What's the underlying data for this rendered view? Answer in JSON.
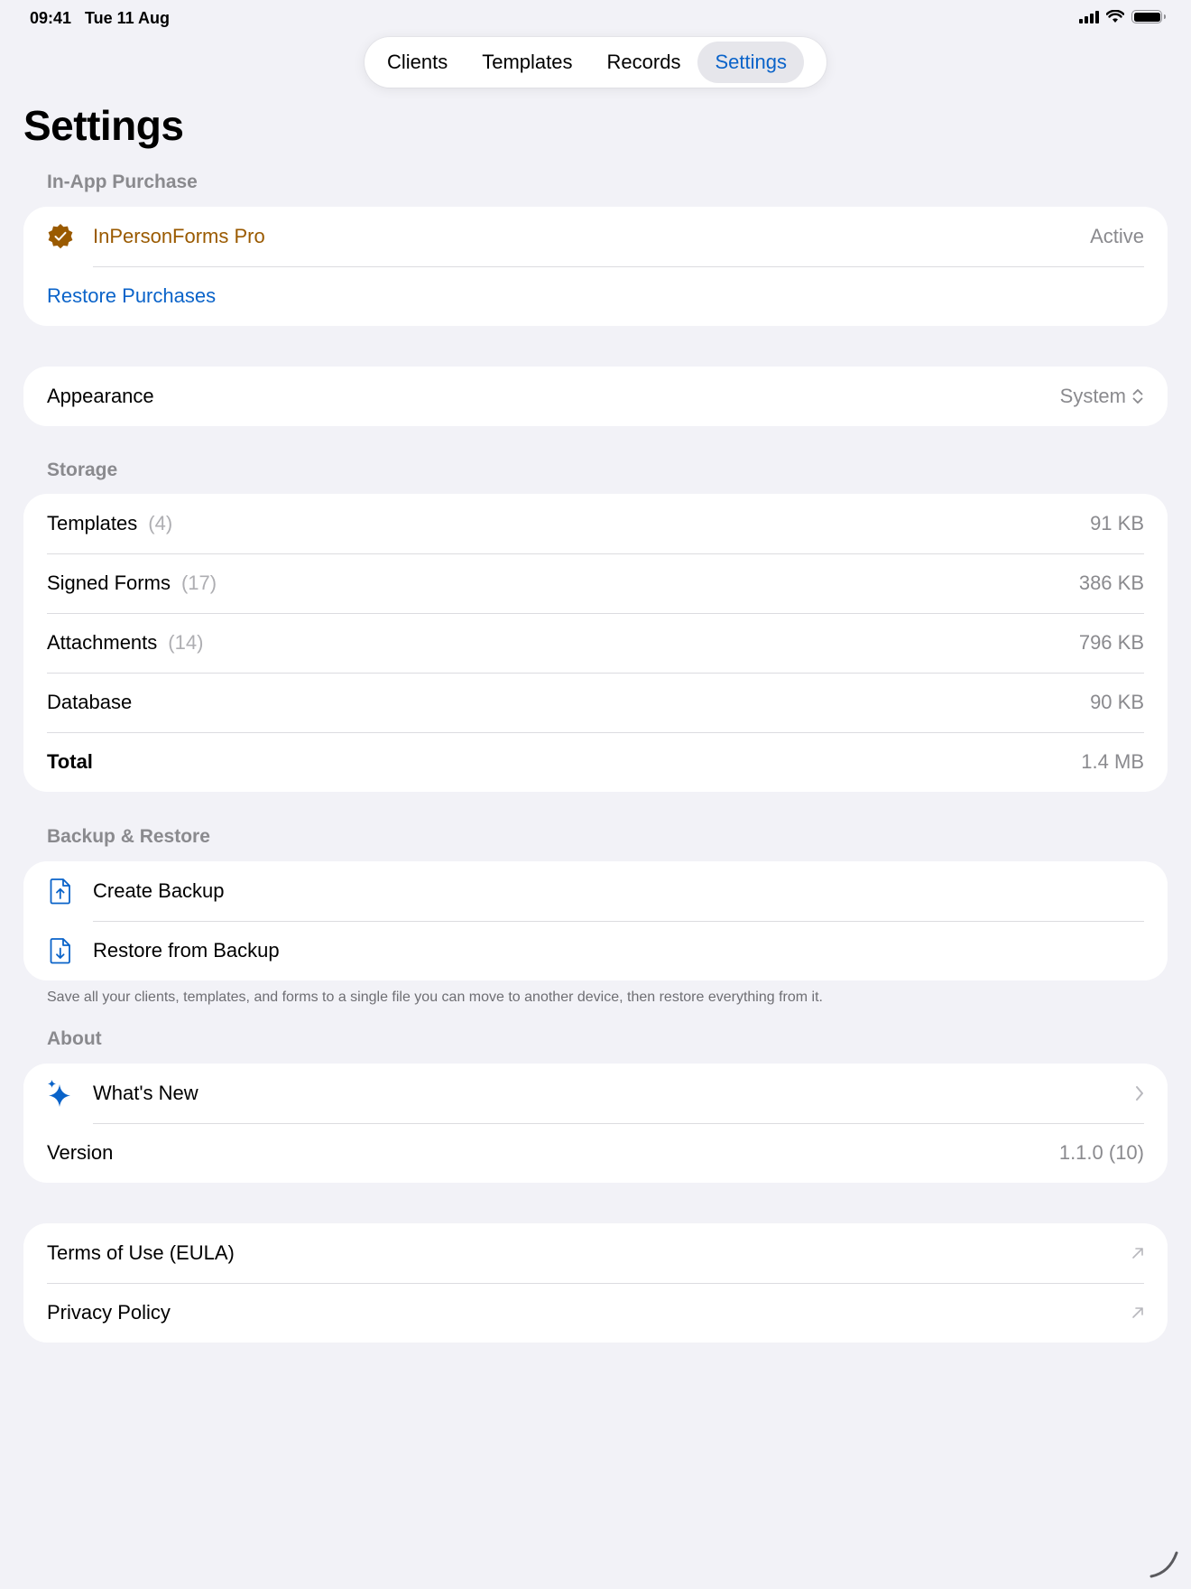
{
  "status": {
    "time": "09:41",
    "date": "Tue 11 Aug"
  },
  "tabs": [
    {
      "label": "Clients"
    },
    {
      "label": "Templates"
    },
    {
      "label": "Records"
    },
    {
      "label": "Settings"
    }
  ],
  "title": "Settings",
  "purchase": {
    "header": "In-App Purchase",
    "product": "InPersonForms Pro",
    "status": "Active",
    "restore": "Restore Purchases"
  },
  "appearance": {
    "label": "Appearance",
    "value": "System"
  },
  "storage": {
    "header": "Storage",
    "rows": [
      {
        "label": "Templates",
        "count": "(4)",
        "size": "91 KB"
      },
      {
        "label": "Signed Forms",
        "count": "(17)",
        "size": "386 KB"
      },
      {
        "label": "Attachments",
        "count": "(14)",
        "size": "796 KB"
      },
      {
        "label": "Database",
        "count": "",
        "size": "90 KB"
      },
      {
        "label": "Total",
        "count": "",
        "size": "1.4 MB"
      }
    ]
  },
  "backup": {
    "header": "Backup & Restore",
    "create": "Create Backup",
    "restore": "Restore from Backup",
    "note": "Save all your clients, templates, and forms to a single file you can move to another device, then restore everything from it."
  },
  "about": {
    "header": "About",
    "whats_new": "What's New",
    "version_label": "Version",
    "version_value": "1.1.0 (10)"
  },
  "legal": {
    "terms": "Terms of Use (EULA)",
    "privacy": "Privacy Policy"
  },
  "colors": {
    "accent": "#0a63c9",
    "pro": "#9a5a00",
    "background": "#f2f2f7"
  }
}
